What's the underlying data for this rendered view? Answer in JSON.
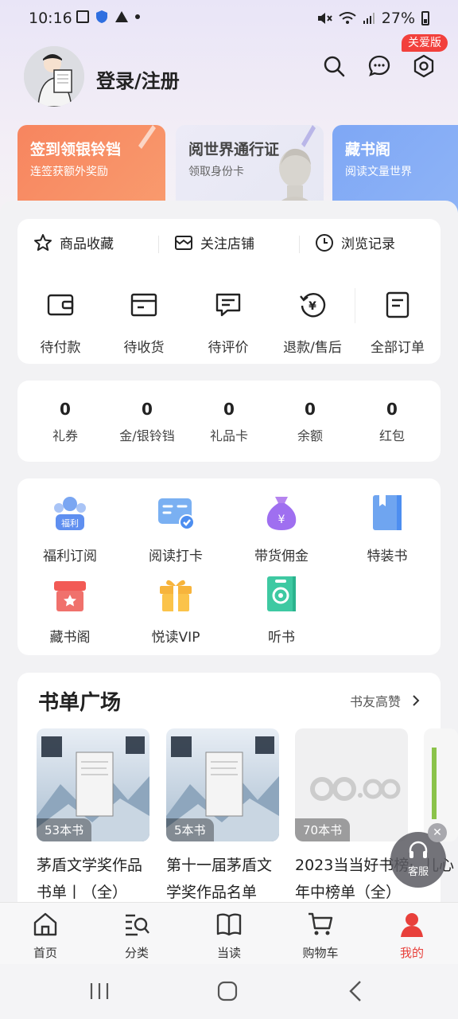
{
  "status_bar": {
    "time": "10:16",
    "battery": "27%"
  },
  "header": {
    "login_label": "登录/注册",
    "care_badge": "关爱版"
  },
  "promos": [
    {
      "title": "签到领银铃铛",
      "subtitle": "连签获额外奖励"
    },
    {
      "title": "阅世界通行证",
      "subtitle": "领取身份卡"
    },
    {
      "title": "藏书阁",
      "subtitle": "阅读文量世界"
    }
  ],
  "quick_links": {
    "favorites": "商品收藏",
    "shops": "关注店铺",
    "history": "浏览记录"
  },
  "orders": {
    "pending_payment": "待付款",
    "pending_receipt": "待收货",
    "pending_review": "待评价",
    "refund": "退款/售后",
    "all": "全部订单"
  },
  "assets": [
    {
      "value": "0",
      "label": "礼券"
    },
    {
      "value": "0",
      "label": "金/银铃铛"
    },
    {
      "value": "0",
      "label": "礼品卡"
    },
    {
      "value": "0",
      "label": "余额"
    },
    {
      "value": "0",
      "label": "红包"
    }
  ],
  "services": {
    "welfare": "福利订阅",
    "reading_checkin": "阅读打卡",
    "commission": "带货佣金",
    "special_books": "特装书",
    "library": "藏书阁",
    "vip": "悦读VIP",
    "audio": "听书"
  },
  "booklists": {
    "title": "书单广场",
    "more": "书友高赞",
    "items": [
      {
        "count": "53本书",
        "title": "茅盾文学奖作品书单丨（全）"
      },
      {
        "count": "5本书",
        "title": "第十一届茅盾文学奖作品名单"
      },
      {
        "count": "70本书",
        "title": "2023当当好书榜·年中榜单（全）"
      }
    ],
    "partial_title": "儿心"
  },
  "service_float": {
    "label": "客服"
  },
  "tabs": {
    "home": "首页",
    "category": "分类",
    "dangdu": "当读",
    "cart": "购物车",
    "mine": "我的"
  },
  "colors": {
    "accent": "#e8403b",
    "promo_orange": "#f7855f",
    "promo_blue": "#7ea7f5"
  }
}
